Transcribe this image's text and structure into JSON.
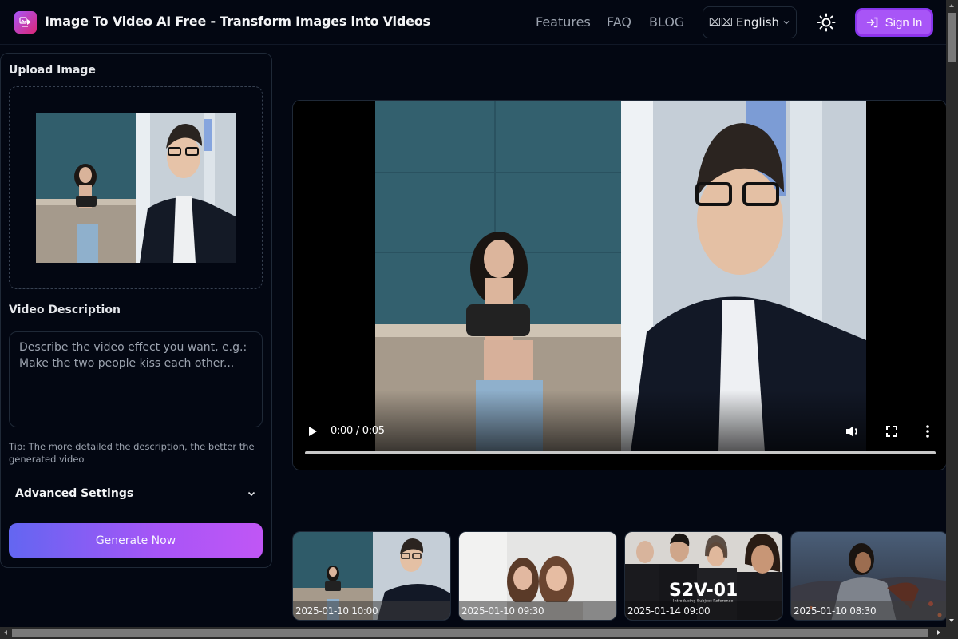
{
  "header": {
    "logo_icon": "image-to-video-icon",
    "title": "Image To Video AI Free - Transform Images into Videos",
    "nav": [
      {
        "label": "Features"
      },
      {
        "label": "FAQ"
      },
      {
        "label": "BLOG"
      }
    ],
    "language": {
      "flag": "⌧⌧",
      "label": "English"
    },
    "theme_icon": "sun-icon",
    "sign_in": {
      "label": "Sign In",
      "icon": "sign-in-icon"
    }
  },
  "left_panel": {
    "upload_label": "Upload Image",
    "description_label": "Video Description",
    "description_value": "",
    "description_placeholder": "Describe the video effect you want, e.g.: Make the two people kiss each other...",
    "tip": "Tip: The more detailed the description, the better the generated video",
    "advanced_settings_label": "Advanced Settings",
    "generate_label": "Generate Now"
  },
  "video": {
    "time": "0:00 / 0:05",
    "progress_percent": 0,
    "controls": [
      "play-icon",
      "volume-icon",
      "fullscreen-icon",
      "more-options-icon"
    ]
  },
  "gallery": [
    {
      "date": "2025-01-10 10:00",
      "scene": "woman-and-man-portrait"
    },
    {
      "date": "2025-01-10 09:30",
      "scene": "two-women-smiling"
    },
    {
      "date": "2025-01-14 09:00",
      "scene": "S2V-01 group portrait",
      "overlay_title": "S2V-01",
      "overlay_subtitle": "Introducing Subject Reference"
    },
    {
      "date": "2025-01-10 08:30",
      "scene": "warrior-battle"
    }
  ],
  "colors": {
    "background": "#030712",
    "accent": "#a855f7",
    "gradient_start": "#6366f1",
    "gradient_end": "#c056f5"
  }
}
